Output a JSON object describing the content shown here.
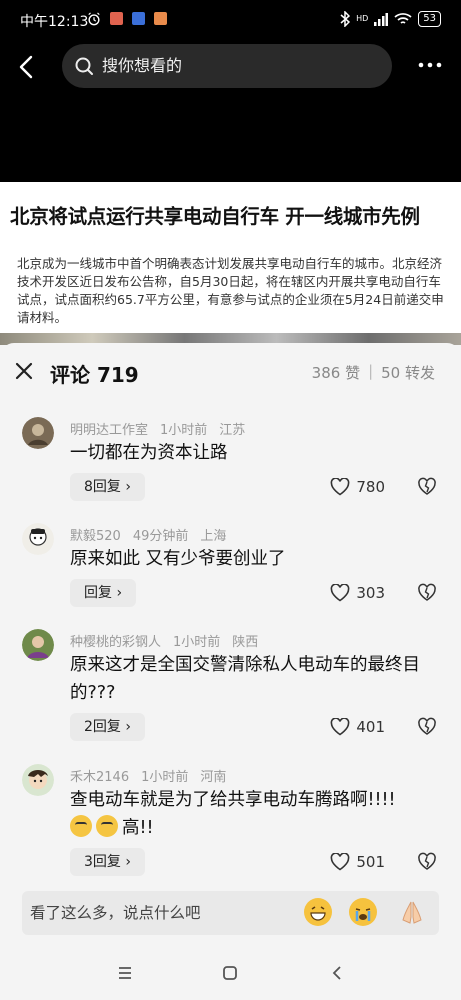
{
  "status_bar": {
    "time": "中午12:13",
    "battery": "53",
    "network": "HD"
  },
  "search": {
    "placeholder": "搜你想看的"
  },
  "article": {
    "title": "北京将试点运行共享电动自行车 开一线城市先例",
    "body": "北京成为一线城市中首个明确表态计划发展共享电动自行车的城市。北京经济技术开发区近日发布公告称，自5月30日起，将在辖区内开展共享电动自行车试点，试点面积约65.7平方公里，有意参与试点的企业须在5月24日前递交申请材料。"
  },
  "comments_header": {
    "title": "评论 719",
    "likes": "386 赞",
    "separator": "|",
    "shares": "50 转发"
  },
  "comments": [
    {
      "user": "明明达工作室",
      "time": "1小时前",
      "location": "江苏",
      "text": "一切都在为资本让路",
      "emoji_suffix": "",
      "replies": "8回复 ›",
      "likes": "780"
    },
    {
      "user": "默毅520",
      "time": "49分钟前",
      "location": "上海",
      "text": "原来如此 又有少爷要创业了",
      "emoji_suffix": "",
      "replies": "回复 ›",
      "likes": "303"
    },
    {
      "user": "种樱桃的彩钢人",
      "time": "1小时前",
      "location": "陕西",
      "text": "原来这才是全国交警清除私人电动车的最终目的???",
      "emoji_suffix": "",
      "replies": "2回复 ›",
      "likes": "401"
    },
    {
      "user": "禾木2146",
      "time": "1小时前",
      "location": "河南",
      "text": "查电动车就是为了给共享电动车腾路啊!!!!",
      "emoji_suffix": "高!!",
      "replies": "3回复 ›",
      "likes": "501"
    }
  ],
  "input": {
    "placeholder": "看了这么多，说点什么吧"
  },
  "icons": {
    "back": "back-arrow-icon",
    "search": "search-icon",
    "more": "more-dots-icon",
    "close": "close-icon",
    "like": "heart-icon",
    "dislike": "broken-heart-icon",
    "emoji": [
      "grin-emoji-icon",
      "cry-emoji-icon",
      "pray-emoji-icon"
    ]
  },
  "colors": {
    "top_bg": "#000000",
    "panel_bg": "#f4f4f4",
    "reply_bg": "#eaeaea"
  }
}
